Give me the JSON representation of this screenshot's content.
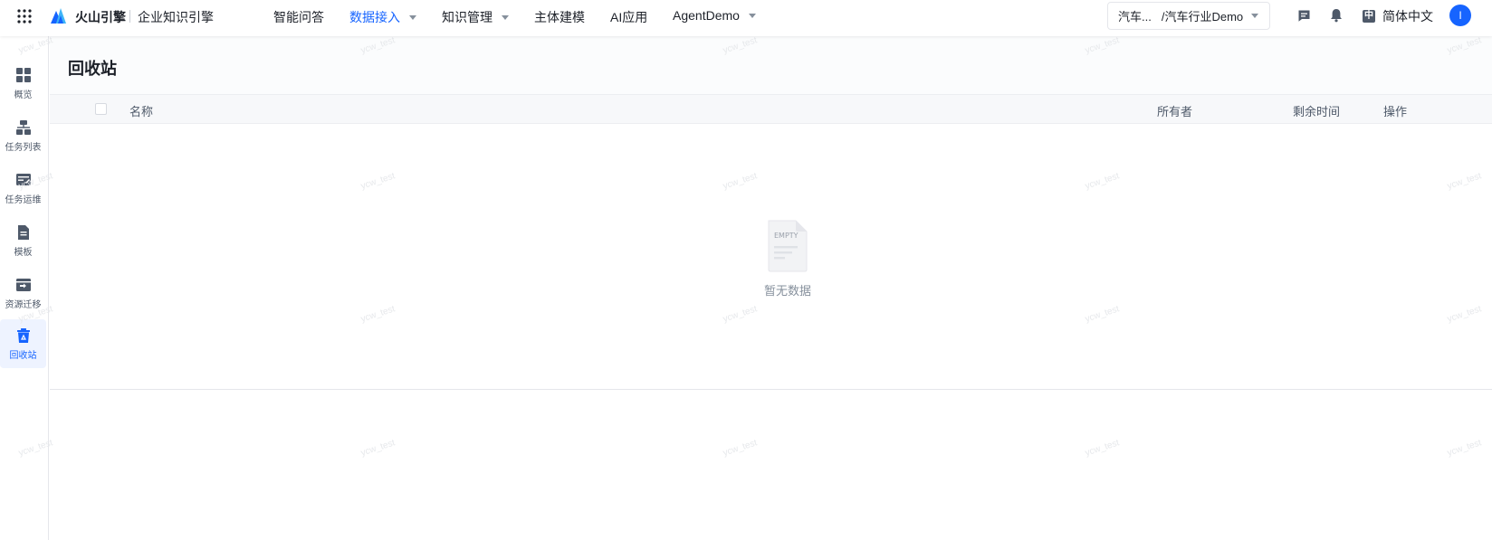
{
  "topbar": {
    "brand_name": "火山引擎",
    "product_name": "企业知识引擎",
    "nav": [
      {
        "label": "智能问答",
        "active": false,
        "dropdown": false
      },
      {
        "label": "数据接入",
        "active": true,
        "dropdown": true
      },
      {
        "label": "知识管理",
        "active": false,
        "dropdown": true
      },
      {
        "label": "主体建模",
        "active": false,
        "dropdown": false
      },
      {
        "label": "AI应用",
        "active": false,
        "dropdown": false
      },
      {
        "label": "AgentDemo",
        "active": false,
        "dropdown": true
      }
    ],
    "project_select": {
      "workspace": "汽车...",
      "project": "/汽车行业Demo"
    },
    "language": {
      "icon_char": "中",
      "label": "简体中文"
    },
    "avatar_initial": "I"
  },
  "sidebar": {
    "items": [
      {
        "label": "概览",
        "icon": "grid-icon",
        "active": false
      },
      {
        "label": "任务列表",
        "icon": "hierarchy-icon",
        "active": false
      },
      {
        "label": "任务运维",
        "icon": "ops-icon",
        "active": false
      },
      {
        "label": "模板",
        "icon": "template-icon",
        "active": false
      },
      {
        "label": "资源迁移",
        "icon": "migrate-icon",
        "active": false
      },
      {
        "label": "回收站",
        "icon": "recycle-bin-icon",
        "active": true
      }
    ]
  },
  "page": {
    "title": "回收站",
    "table": {
      "columns": {
        "name": "名称",
        "owner": "所有者",
        "remaining": "剩余时间",
        "actions": "操作"
      },
      "rows": []
    },
    "empty": {
      "image_text": "EMPTY",
      "text": "暂无数据"
    }
  },
  "watermark": "ycw_test",
  "colors": {
    "accent": "#1664ff",
    "text": "#1d2129",
    "muted": "#86909c"
  }
}
